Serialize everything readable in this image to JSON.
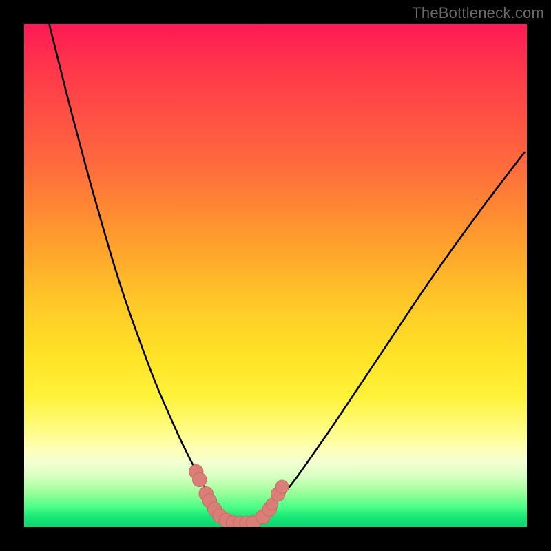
{
  "watermark": "TheBottleneck.com",
  "colors": {
    "background": "#000000",
    "curve": "#000000",
    "marker_fill": "#d97f77",
    "marker_stroke": "#c96a62"
  },
  "chart_data": {
    "type": "line",
    "title": "",
    "xlabel": "",
    "ylabel": "",
    "xlim": [
      0,
      100
    ],
    "ylim": [
      0,
      100
    ],
    "grid": false,
    "legend": false,
    "series": [
      {
        "name": "left-curve",
        "x": [
          5,
          7,
          9,
          11,
          13,
          15,
          17,
          19,
          21,
          23,
          25,
          27,
          29,
          31,
          33,
          34.5,
          36,
          37.5,
          39,
          40.5
        ],
        "values": [
          100,
          92,
          84,
          76.5,
          69,
          62,
          55,
          48.5,
          42.5,
          37,
          31.5,
          26.5,
          22,
          17.5,
          13.5,
          10.5,
          7.8,
          5.3,
          3.2,
          1.6
        ]
      },
      {
        "name": "right-curve",
        "x": [
          47,
          49,
          51,
          54,
          57,
          61,
          65,
          70,
          75,
          80,
          86,
          92,
          99.5
        ],
        "values": [
          1.8,
          3.6,
          5.8,
          9.5,
          13.8,
          19.5,
          25.5,
          33,
          40.5,
          48,
          56.5,
          64.7,
          74.5
        ]
      }
    ],
    "annotations": {
      "markers": [
        {
          "x": 34.2,
          "y": 11.0,
          "r": 1.4
        },
        {
          "x": 34.9,
          "y": 9.4,
          "r": 1.4
        },
        {
          "x": 36.2,
          "y": 6.6,
          "r": 1.4
        },
        {
          "x": 36.9,
          "y": 5.2,
          "r": 1.4
        },
        {
          "x": 37.9,
          "y": 3.5,
          "r": 1.4
        },
        {
          "x": 38.9,
          "y": 2.2,
          "r": 1.4
        },
        {
          "x": 40.2,
          "y": 1.3,
          "r": 1.4
        },
        {
          "x": 41.6,
          "y": 0.85,
          "r": 1.4
        },
        {
          "x": 43.0,
          "y": 0.75,
          "r": 1.4
        },
        {
          "x": 44.3,
          "y": 0.75,
          "r": 1.4
        },
        {
          "x": 45.6,
          "y": 0.85,
          "r": 1.4
        },
        {
          "x": 47.5,
          "y": 2.0,
          "r": 1.4
        },
        {
          "x": 48.8,
          "y": 3.5,
          "r": 1.4
        },
        {
          "x": 49.3,
          "y": 4.5,
          "r": 1.2
        },
        {
          "x": 50.5,
          "y": 6.5,
          "r": 1.4
        },
        {
          "x": 51.3,
          "y": 8.0,
          "r": 1.3
        }
      ]
    }
  }
}
